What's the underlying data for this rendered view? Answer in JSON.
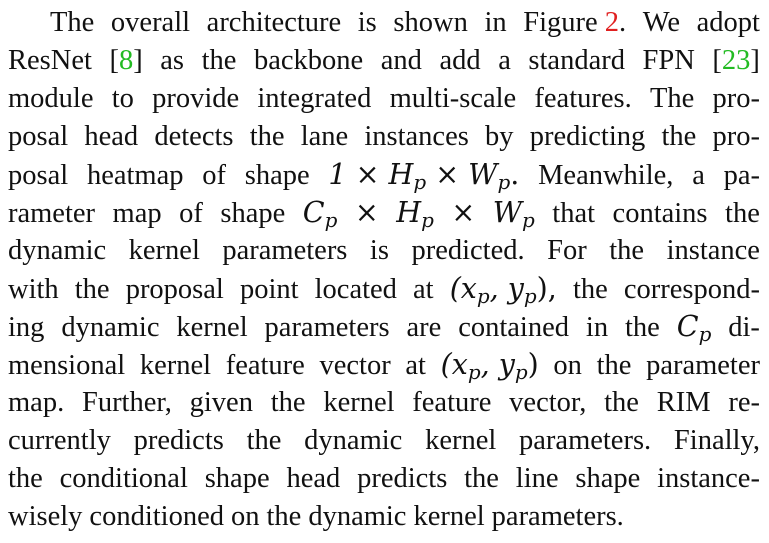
{
  "paragraph": {
    "l1": [
      "The",
      "overall",
      "architecture",
      "is",
      "shown",
      "in",
      "Figure",
      "2",
      ".",
      "We",
      "adopt"
    ],
    "l2": [
      "ResNet",
      "[8]",
      "as",
      "the",
      "backbone",
      "and",
      "add",
      "a",
      "standard",
      "FPN",
      "[23]"
    ],
    "l3": [
      "module",
      "to",
      "provide",
      "integrated",
      "multi-scale",
      "features.",
      "The",
      "pro-"
    ],
    "l4": [
      "posal",
      "head",
      "detects",
      "the",
      "lane",
      "instances",
      "by",
      "predicting",
      "the",
      "pro-"
    ],
    "l5": [
      "posal",
      "heatmap",
      "of",
      "shape",
      "1 × H",
      "p",
      " × W",
      "p",
      ".",
      "Meanwhile,",
      "a",
      "pa-"
    ],
    "l6": [
      "rameter",
      "map",
      "of",
      "shape",
      "C",
      "p",
      "×",
      "H",
      "p",
      "×",
      "W",
      "p",
      "that",
      "contains",
      "the"
    ],
    "l7": [
      "dynamic",
      "kernel",
      "parameters",
      "is",
      "predicted.",
      "For",
      "the",
      "instance"
    ],
    "l8": [
      "with",
      "the",
      "proposal",
      "point",
      "located",
      "at",
      "(x",
      "p",
      ", y",
      "p",
      "),",
      "the",
      "correspond-"
    ],
    "l9": [
      "ing",
      "dynamic",
      "kernel",
      "parameters",
      "are",
      "contained",
      "in",
      "the",
      "C",
      "p",
      "di-"
    ],
    "l10": [
      "mensional",
      "kernel",
      "feature",
      "vector",
      "at",
      "(x",
      "p",
      ", y",
      "p",
      ")",
      "on",
      "the",
      "parameter"
    ],
    "l11": [
      "map.",
      "Further,",
      "given",
      "the",
      "kernel",
      "feature",
      "vector,",
      "the",
      "RIM",
      "re-"
    ],
    "l12": [
      "currently",
      "predicts",
      "the",
      "dynamic",
      "kernel",
      "parameters.",
      "Finally,"
    ],
    "l13": [
      "the",
      "conditional",
      "shape",
      "head",
      "predicts",
      "the",
      "line",
      "shape",
      "instance-"
    ],
    "l14": [
      "wisely",
      "conditioned",
      "on",
      "the",
      "dynamic",
      "kernel",
      "parameters."
    ]
  },
  "colors": {
    "text": "#111111",
    "citation": "#22bb22"
  }
}
